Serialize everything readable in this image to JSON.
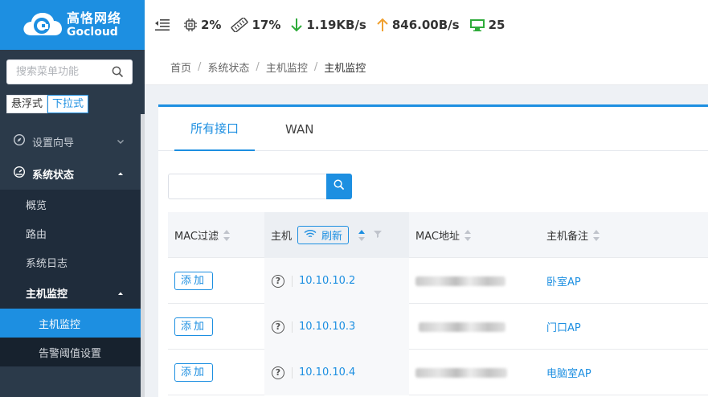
{
  "brand": {
    "name_cn": "高恪网络",
    "name_en": "Gocloud",
    "registered": "®"
  },
  "topbar": {
    "cpu": "2%",
    "memory": "17%",
    "download": "1.19KB/s",
    "upload": "846.00B/s",
    "online_hosts": "25",
    "colors": {
      "download": "#2eab3a",
      "upload": "#f0a030",
      "monitor": "#2eab3a"
    }
  },
  "sidebar": {
    "search_placeholder": "搜索菜单功能",
    "mode_float": "悬浮式",
    "mode_dropdown": "下拉式",
    "menu": {
      "setup_wizard": "设置向导",
      "system_status": "系统状态",
      "overview": "概览",
      "routing": "路由",
      "system_log": "系统日志",
      "host_monitor_group": "主机监控",
      "host_monitor": "主机监控",
      "alarm_threshold": "告警阈值设置"
    }
  },
  "breadcrumb": {
    "home": "首页",
    "level1": "系统状态",
    "level2": "主机监控",
    "current": "主机监控"
  },
  "tabs": {
    "all": "所有接口",
    "wan": "WAN"
  },
  "table": {
    "headers": {
      "mac_filter": "MAC过滤",
      "host": "主机",
      "refresh": "刷新",
      "mac": "MAC地址",
      "remark": "主机备注"
    },
    "add_label": "添加",
    "rows": [
      {
        "ip": "10.10.10.2",
        "remark": "卧室AP"
      },
      {
        "ip": "10.10.10.3",
        "remark": "门口AP"
      },
      {
        "ip": "10.10.10.4",
        "remark": "电脑室AP"
      }
    ]
  },
  "accent_color": "#1d8fe1"
}
